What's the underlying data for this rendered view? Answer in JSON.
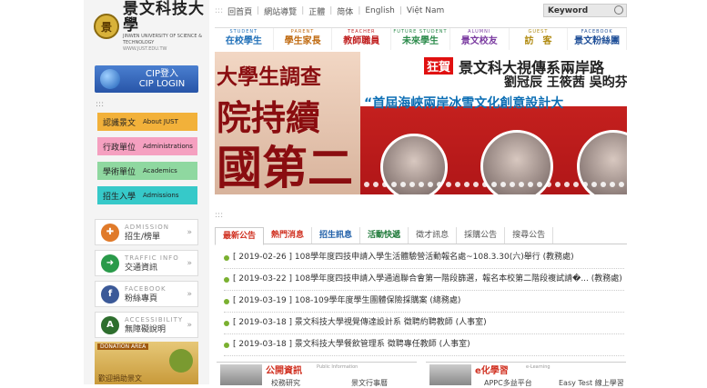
{
  "logo": {
    "name": "景文科技大學",
    "sub": "JINWEN UNIVERSITY OF SCIENCE & TECHNOLOGY",
    "url": "WWW.JUST.EDU.TW",
    "seal": "景"
  },
  "cip": {
    "line1": "CIP登入",
    "line2": "CIP LOGIN"
  },
  "left_menu": [
    {
      "zh": "認識景文",
      "en": "About JUST",
      "color": "#f2b13a"
    },
    {
      "zh": "行政單位",
      "en": "Administrations",
      "color": "#f5a0c0"
    },
    {
      "zh": "學術單位",
      "en": "Academics",
      "color": "#8fd8a0"
    },
    {
      "zh": "招生入學",
      "en": "Admissions",
      "color": "#36c9c9"
    }
  ],
  "info_links": [
    {
      "en": "ADMISSION",
      "zh": "招生/榜單",
      "icon": "admission-icon",
      "color": "#e07a2a",
      "glyph": "✚"
    },
    {
      "en": "TRAFFIC INFO",
      "zh": "交通資訊",
      "icon": "traffic-icon",
      "color": "#2a9a4a",
      "glyph": "➜"
    },
    {
      "en": "FACEBOOK",
      "zh": "粉絲專頁",
      "icon": "facebook-icon",
      "color": "#3b5998",
      "glyph": "f"
    },
    {
      "en": "ACCESSIBILITY",
      "zh": "無障礙說明",
      "icon": "accessibility-icon",
      "color": "#2e6e2e",
      "glyph": "A"
    }
  ],
  "donation": {
    "title": "DONATION AREA",
    "zh": "歡迎捐助景文"
  },
  "topnav": [
    "回首頁",
    "網站導覽",
    "正體",
    "简体",
    "English",
    "Việt Nam"
  ],
  "search": {
    "placeholder": "Keyword"
  },
  "mainnav": [
    {
      "en": "STUDENT",
      "zh": "在校學生"
    },
    {
      "en": "PARENT",
      "zh": "學生家長"
    },
    {
      "en": "TEACHER",
      "zh": "教師職員"
    },
    {
      "en": "FUTURE STUDENT",
      "zh": "未來學生"
    },
    {
      "en": "ALUMNI",
      "zh": "景文校友"
    },
    {
      "en": "GUEST",
      "zh": "訪　客"
    },
    {
      "en": "FACEBOOK",
      "zh": "景文粉絲團"
    }
  ],
  "banner": {
    "left1": "大學生調查",
    "left2": "院持續",
    "left3": "國第二名",
    "badge": "狂賀",
    "h1": "景文科大視傳系兩岸路",
    "h2": "劉冠辰 王筱茜 吳昀芬",
    "h3": "“首屆海峽兩岸冰雪文化創意設計大"
  },
  "tabs": [
    "最新公告",
    "熱門消息",
    "招生訊息",
    "活動快遞",
    "徵才訊息",
    "採購公告",
    "搜尋公告"
  ],
  "news": [
    "[ 2019-02-26 ] 108學年度四技申請入學生活體驗營活動報名處~108.3.30(六)舉行 (教務處)",
    "[ 2019-03-22 ] 108學年度四技申請入學通過聯合會第一階段篩選，報名本校第二階段複試請�... (教務處)",
    "[ 2019-03-19 ] 108-109學年度學生團體保險採購案 (總務處)",
    "[ 2019-03-18 ] 景文科技大學視覺傳達設計系 徵聘約聘教師 (人事室)",
    "[ 2019-03-18 ] 景文科技大學餐飲管理系 徵聘專任教師 (人事室)"
  ],
  "boxes": [
    {
      "title": "公開資訊",
      "en": "Public Information",
      "link1": "校務研究",
      "link2": "景文行事曆",
      "color": "#d03020"
    },
    {
      "title": "e化學習",
      "en": "e-Learning",
      "link1": "APPC多益平台",
      "link2": "Easy Test 線上學習",
      "color": "#d03020"
    }
  ],
  "colors": {
    "accent": "#d03020",
    "navblue": "#1f5fa8"
  }
}
